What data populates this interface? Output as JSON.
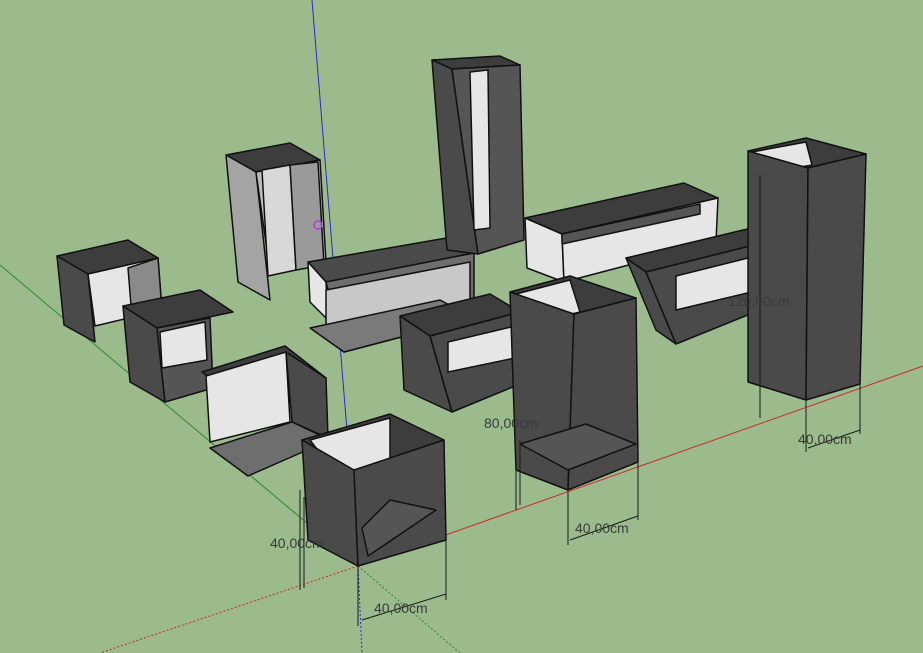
{
  "scene": {
    "background_color": "#9bbb8d",
    "axes": {
      "red": "#cc2a2a",
      "green": "#2a8a2a",
      "blue": "#2a2ad0"
    },
    "face_colors": {
      "dark": "#4a4a4a",
      "mid": "#6e6e6e",
      "light_gray": "#a4a4a4",
      "pale": "#e6e6e6",
      "edge": "#111111"
    },
    "dimensions": [
      {
        "label": "40,00cm"
      },
      {
        "label": "40,00cm"
      },
      {
        "label": "80,00cm"
      },
      {
        "label": "40,00cm"
      },
      {
        "label": "120,00cm"
      },
      {
        "label": "40,00cm"
      }
    ]
  }
}
